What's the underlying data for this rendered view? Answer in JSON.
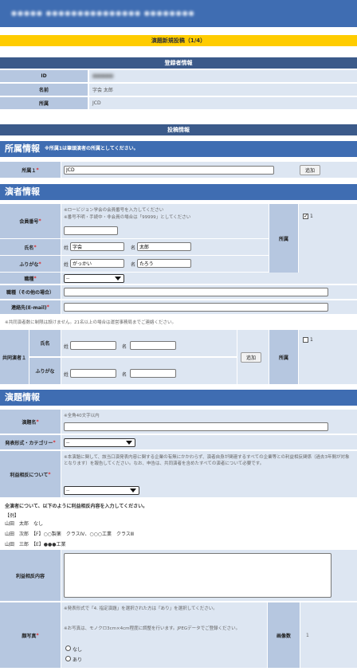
{
  "header": {
    "site_title": "●●●●● ●●●●●●●●●●●●●●● ●●●●●●●●"
  },
  "page_indicator": "演題新規投稿（1/4）",
  "registrant": {
    "section_title": "登録者情報",
    "rows": [
      {
        "label": "ID",
        "value": "●●●●●"
      },
      {
        "label": "名前",
        "value": "字会 太郎"
      },
      {
        "label": "所属",
        "value": "JCD"
      }
    ]
  },
  "submission": {
    "section_title": "投稿情報"
  },
  "affiliation": {
    "heading": "所属情報",
    "subheading": "※所属1は筆頭演者の所属としてください。",
    "label": "所属１",
    "value": "JCD",
    "add_button": "追加"
  },
  "presenter": {
    "heading": "演者情報",
    "member_no": {
      "label": "会員番号",
      "note1": "※ロービジョン学会の会員番号を入力してください",
      "note2": "※番号不明・手続中・非会員の場合は「99999」としてください",
      "value": ""
    },
    "affil_label": "所属",
    "affil_check": "1",
    "name": {
      "label": "氏名",
      "last_prefix": "姓",
      "last": "字会",
      "first_prefix": "名",
      "first": "太郎"
    },
    "kana": {
      "label": "ふりがな",
      "last_prefix": "姓",
      "last": "がっかい",
      "first_prefix": "名",
      "first": "たろう"
    },
    "job": {
      "label": "職種",
      "value": "--"
    },
    "job_other": {
      "label": "職種（その他の場合）",
      "value": ""
    },
    "email": {
      "label": "連絡先(E-mail)",
      "value": ""
    },
    "coauthor_note": "※共同演者数に制限は設けません。21名以上の場合は運営事務局までご連絡ください。",
    "coauthor": {
      "label": "共同演者１",
      "name_label": "氏名",
      "kana_label": "ふりがな",
      "last_prefix": "姓",
      "first_prefix": "名",
      "add_button": "追加",
      "affil_label": "所属",
      "affil_check": "1"
    }
  },
  "abstract": {
    "heading": "演題情報",
    "title": {
      "label": "演題名",
      "note": "※全角40文字以内",
      "value": ""
    },
    "category": {
      "label": "発表形式・カテゴリー",
      "value": "--"
    },
    "coi": {
      "label": "利益相反について",
      "note": "※本演題に関して、該当口演発表内容に関する企業の有無にかかわらず、演者自身が関連するすべての企業等との利益相反関係（過去3年間が対象となります）を報告してください。なお、申告は、共同演者を含めたすべての演者について必要です。",
      "value": "--"
    },
    "coi_instruction": "全演者について、以下のように利益相反内容を入力してください。",
    "coi_examples": [
      "【例】",
      "山田　太郎　なし",
      "山田　次郎　【F】○○製薬　クラスⅣ、○○○工業　クラスⅢ",
      "山田　三郎　【E】●●●工業"
    ],
    "coi_content": {
      "label": "利益相反内容",
      "value": ""
    },
    "photo": {
      "label": "顔写真",
      "note1": "※発表形式で「4. 指定演題」を選択された方は「あり」を選択してください。",
      "note2": "※お写真は、モノクロ3cm×4cm程度に調整を行います。JPEGデータでご登録ください。",
      "option_none": "なし",
      "option_yes": "あり",
      "count_label": "画像数",
      "count_value": "1"
    }
  }
}
